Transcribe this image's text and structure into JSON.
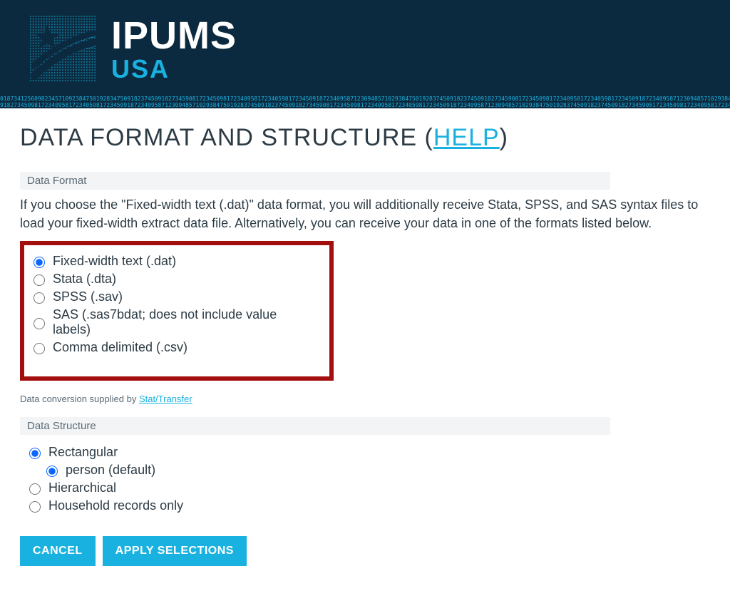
{
  "branding": {
    "title1": "IPUMS",
    "title2": "USA"
  },
  "page": {
    "title_prefix": "DATA FORMAT AND STRUCTURE ",
    "help_open": "(",
    "help_label": "HELP",
    "help_close": ")"
  },
  "data_format": {
    "header": "Data Format",
    "explain": "If you choose the \"Fixed-width text (.dat)\" data format, you will additionally receive Stata, SPSS, and SAS syntax files to load your fixed-width extract data file. Alternatively, you can receive your data in one of the formats listed below.",
    "options": [
      {
        "label": "Fixed-width text (.dat)",
        "selected": true
      },
      {
        "label": "Stata (.dta)",
        "selected": false
      },
      {
        "label": "SPSS (.sav)",
        "selected": false
      },
      {
        "label": "SAS (.sas7bdat; does not include value labels)",
        "selected": false
      },
      {
        "label": "Comma delimited (.csv)",
        "selected": false
      }
    ],
    "conversion_prefix": "Data conversion supplied by ",
    "conversion_link": "Stat/Transfer"
  },
  "data_structure": {
    "header": "Data Structure",
    "options": [
      {
        "label": "Rectangular",
        "selected": true,
        "nested": false
      },
      {
        "label": "person (default)",
        "selected": true,
        "nested": true
      },
      {
        "label": "Hierarchical",
        "selected": false,
        "nested": false
      },
      {
        "label": "Household records only",
        "selected": false,
        "nested": false
      }
    ]
  },
  "buttons": {
    "cancel": "CANCEL",
    "apply": "APPLY SELECTIONS"
  }
}
